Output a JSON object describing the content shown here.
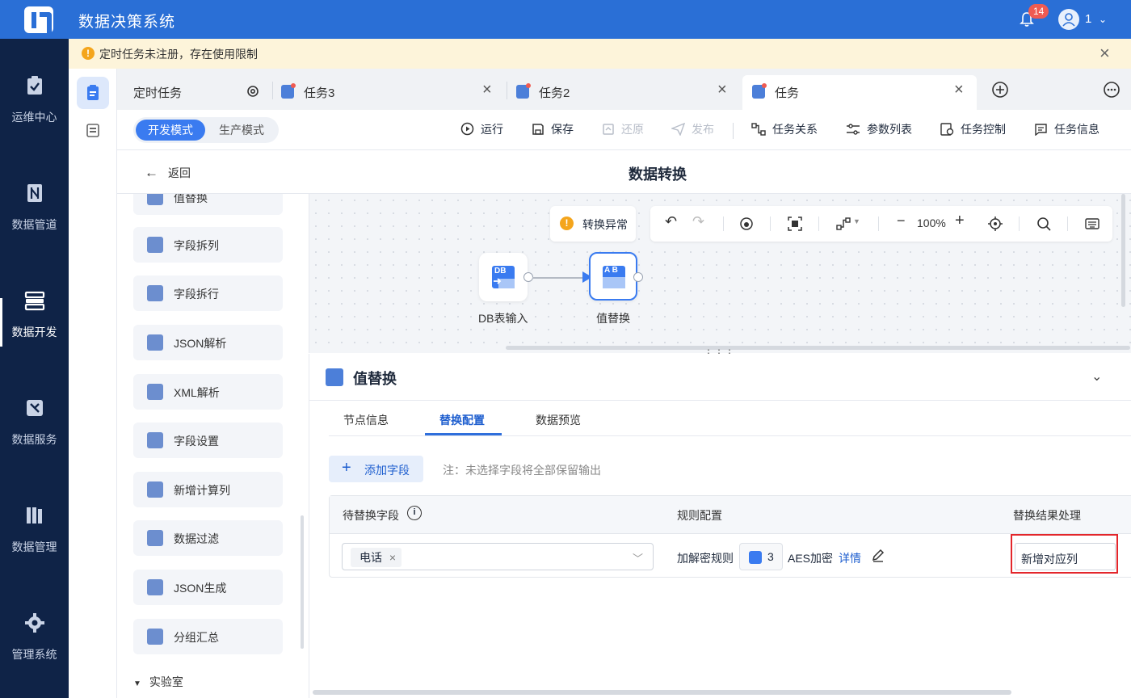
{
  "app": {
    "title": "数据决策系统",
    "notifications": "14",
    "user": "1"
  },
  "notice": {
    "text": "定时任务未注册，存在使用限制"
  },
  "nav": [
    {
      "label": "运维中心",
      "icon": "clipboard-check-icon"
    },
    {
      "label": "数据管道",
      "icon": "pipeline-icon"
    },
    {
      "label": "数据开发",
      "icon": "server-stack-icon"
    },
    {
      "label": "数据服务",
      "icon": "service-icon"
    },
    {
      "label": "数据管理",
      "icon": "library-icon"
    },
    {
      "label": "管理系统",
      "icon": "gear-icon"
    }
  ],
  "tabs": [
    {
      "label": "定时任务"
    },
    {
      "label": "任务3"
    },
    {
      "label": "任务2"
    },
    {
      "label": "任务"
    }
  ],
  "modes": {
    "dev": "开发模式",
    "prod": "生产模式"
  },
  "toolbar": {
    "run": "运行",
    "save": "保存",
    "restore": "还原",
    "publish": "发布",
    "relation": "任务关系",
    "params": "参数列表",
    "control": "任务控制",
    "info": "任务信息"
  },
  "header": {
    "back": "返回",
    "title": "数据转换"
  },
  "components": [
    {
      "label": "值替换"
    },
    {
      "label": "字段拆列"
    },
    {
      "label": "字段拆行"
    },
    {
      "label": "JSON解析"
    },
    {
      "label": "XML解析"
    },
    {
      "label": "字段设置"
    },
    {
      "label": "新增计算列"
    },
    {
      "label": "数据过滤"
    },
    {
      "label": "JSON生成"
    },
    {
      "label": "分组汇总"
    }
  ],
  "lab": "实验室",
  "canvas": {
    "warning": "转换异常",
    "zoom": "100%",
    "nodes": [
      {
        "label": "DB表输入",
        "icon_text": "DB"
      },
      {
        "label": "值替换",
        "icon_text": "A B"
      }
    ]
  },
  "panel": {
    "title": "值替换",
    "tabs": [
      "节点信息",
      "替换配置",
      "数据预览"
    ],
    "add_field": "添加字段",
    "note": "注：未选择字段将全部保留输出",
    "columns": [
      "待替换字段",
      "规则配置",
      "替换结果处理"
    ],
    "row": {
      "field": "电话",
      "rule_label": "加解密规则",
      "rule_count": "3",
      "rule_name": "AES加密",
      "detail": "详情",
      "result": "新增对应列"
    }
  },
  "colors": {
    "brand": "#2a6fd6",
    "nav_bg": "#0f2347",
    "accent": "#3a7bf0",
    "highlight": "#e3262b"
  }
}
